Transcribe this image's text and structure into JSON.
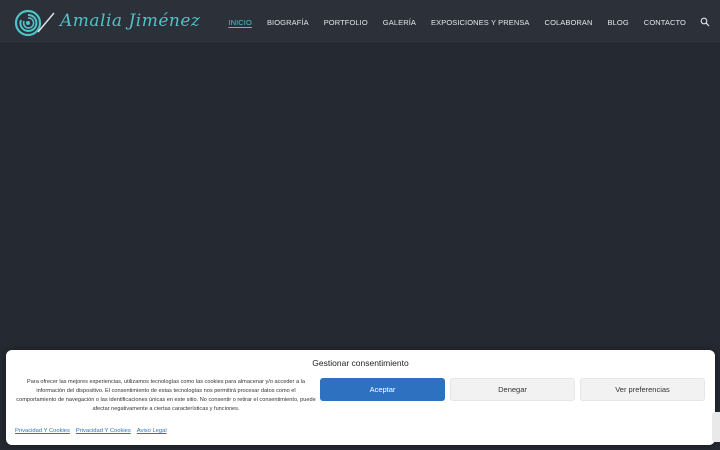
{
  "header": {
    "logo_text": "Amalia Jiménez",
    "nav": [
      {
        "label": "INICIO",
        "active": true
      },
      {
        "label": "BIOGRAFÍA"
      },
      {
        "label": "PORTFOLIO"
      },
      {
        "label": "GALERÍA"
      },
      {
        "label": "EXPOSICIONES Y PRENSA"
      },
      {
        "label": "COLABORAN"
      },
      {
        "label": "BLOG"
      },
      {
        "label": "CONTACTO"
      }
    ],
    "search_icon": "search-icon"
  },
  "consent": {
    "title": "Gestionar consentimiento",
    "text": "Para ofrecer las mejores experiencias, utilizamos tecnologías como las cookies para almacenar y/o acceder a la información del dispositivo. El consentimiento de estas tecnologías nos permitirá procesar datos como el comportamiento de navegación o las identificaciones únicas en este sitio. No consentir o retirar el consentimiento, puede afectar negativamente a ciertas características y funciones.",
    "accept_label": "Aceptar",
    "deny_label": "Denegar",
    "prefs_label": "Ver preferencias",
    "links": [
      "Privacidad Y Cookies",
      "Privacidad Y Cookies",
      "Aviso Legal"
    ]
  },
  "colors": {
    "background": "#252932",
    "header": "#2b3039",
    "accent": "#4fc3c7",
    "button_primary": "#2e71c1"
  }
}
